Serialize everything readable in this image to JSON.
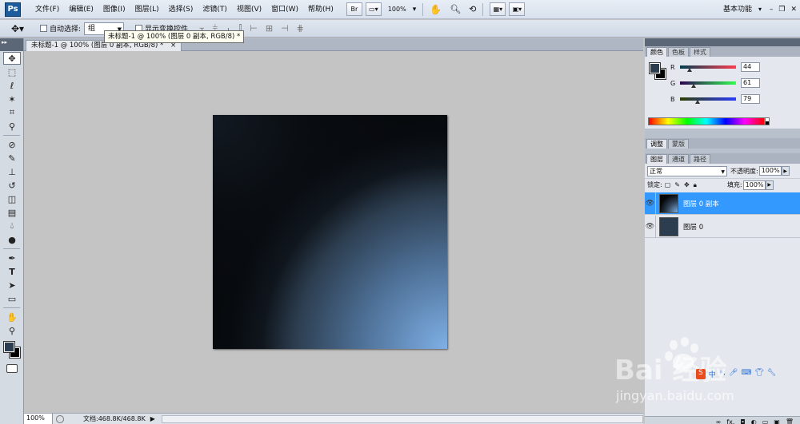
{
  "app": {
    "logo": "Ps",
    "menu": [
      "文件(F)",
      "编辑(E)",
      "图像(I)",
      "图层(L)",
      "选择(S)",
      "滤镜(T)",
      "视图(V)",
      "窗口(W)",
      "帮助(H)"
    ],
    "bridge_label": "Br",
    "zoom": "100%",
    "workspace": "基本功能"
  },
  "options": {
    "auto_select_label": "自动选择:",
    "auto_select_value": "组",
    "show_transform_label": "显示变换控件"
  },
  "document": {
    "tab_title": "未标题-1 @ 100% (图层 0 副本, RGB/8) *",
    "tooltip": "未标题-1 @ 100% (图层 0 副本, RGB/8) *",
    "close_glyph": "×"
  },
  "status": {
    "zoom": "100%",
    "doc_info": "文档:468.8K/468.8K"
  },
  "color_panel": {
    "tabs": [
      "颜色",
      "色板",
      "样式"
    ],
    "channels": [
      {
        "label": "R",
        "value": "44"
      },
      {
        "label": "G",
        "value": "61"
      },
      {
        "label": "B",
        "value": "79"
      }
    ],
    "foreground": "#2c3d4f",
    "background": "#000000"
  },
  "adjust_tabs": [
    "调整",
    "蒙版"
  ],
  "layers_panel": {
    "tabs": [
      "图层",
      "通道",
      "路径"
    ],
    "blend_mode": "正常",
    "opacity_label": "不透明度:",
    "opacity": "100%",
    "lock_label": "锁定:",
    "fill_label": "填充:",
    "fill": "100%",
    "layers": [
      {
        "name": "图层 0 副本",
        "selected": true
      },
      {
        "name": "图层 0",
        "selected": false
      }
    ]
  },
  "watermark": {
    "brand": "Bai  经验",
    "url": "jingyan.baidu.com"
  }
}
